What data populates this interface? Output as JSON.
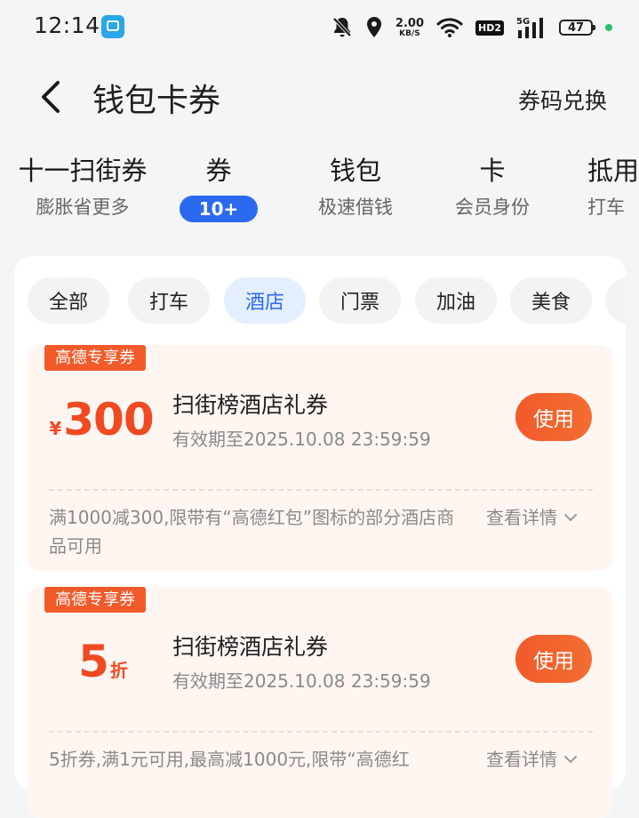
{
  "status_bar": {
    "time": "12:14",
    "net_speed_value": "2.00",
    "net_speed_unit": "KB/S",
    "hd_label": "HD2",
    "signal_label": "5G",
    "battery": "47",
    "icons": [
      "mute-bell-icon",
      "location-icon",
      "wifi-icon",
      "signal-icon"
    ]
  },
  "header": {
    "title": "钱包卡券",
    "action": "券码兑换",
    "back_icon": "chevron-left-icon"
  },
  "category_tabs": [
    {
      "title": "十一扫街券",
      "subtitle": "膨胀省更多"
    },
    {
      "title": "券",
      "badge": "10+",
      "active": true
    },
    {
      "title": "钱包",
      "subtitle": "极速借钱"
    },
    {
      "title": "卡",
      "subtitle": "会员身份"
    },
    {
      "title": "抵用",
      "subtitle": "打车"
    }
  ],
  "filters": [
    {
      "label": "全部"
    },
    {
      "label": "打车"
    },
    {
      "label": "酒店",
      "active": true
    },
    {
      "label": "门票"
    },
    {
      "label": "加油"
    },
    {
      "label": "美食"
    },
    {
      "label": ""
    }
  ],
  "coupons": [
    {
      "tag": "高德专享券",
      "currency": "¥",
      "value": "300",
      "suffix": "",
      "name": "扫街榜酒店礼券",
      "validity": "有效期至2025.10.08 23:59:59",
      "use_label": "使用",
      "description": "满1000减300,限带有“高德红包”图标的部分酒店商品可用",
      "detail_label": "查看详情"
    },
    {
      "tag": "高德专享券",
      "currency": "",
      "value": "5",
      "suffix": "折",
      "name": "扫街榜酒店礼券",
      "validity": "有效期至2025.10.08 23:59:59",
      "use_label": "使用",
      "description": "5折券,满1元可用,最高减1000元,限带“高德红",
      "detail_label": "查看详情"
    }
  ],
  "colors": {
    "accent_blue": "#2b6af0",
    "coupon_orange": "#f25a2a",
    "coupon_bg": "#fff6f2"
  }
}
